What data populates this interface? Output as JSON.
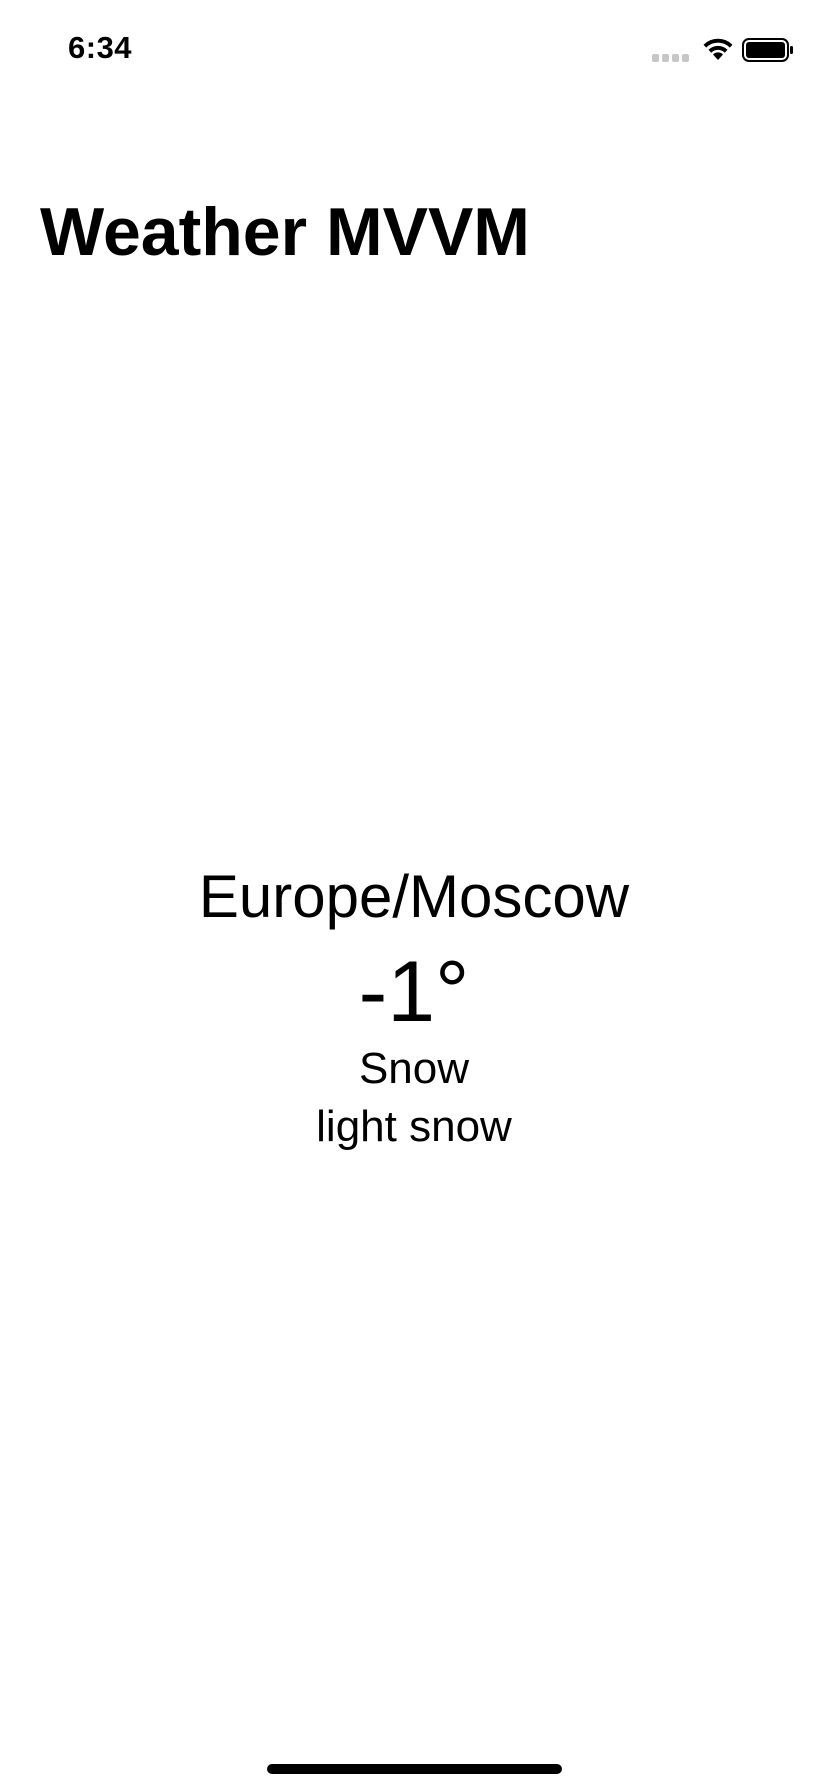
{
  "status_bar": {
    "time": "6:34",
    "signal_icon": "cellular-signal-icon",
    "wifi_icon": "wifi-icon",
    "battery_icon": "battery-icon",
    "battery_level": 1.0
  },
  "navigation": {
    "title": "Weather MVVM"
  },
  "weather": {
    "city": "Europe/Moscow",
    "temperature": "-1°",
    "condition": "Snow",
    "description": "light snow"
  },
  "colors": {
    "background": "#ffffff",
    "text": "#000000",
    "signal_inactive": "#c7c7c7"
  }
}
